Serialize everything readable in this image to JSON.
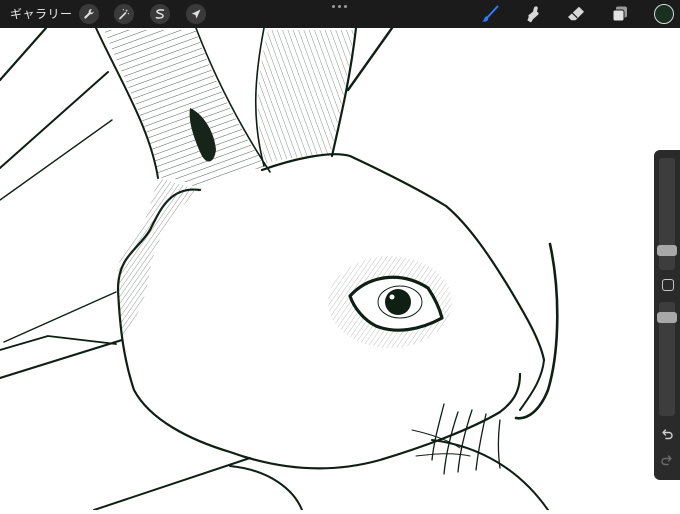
{
  "toolbar": {
    "gallery_label": "ギャラリー",
    "left_tools": [
      "wrench-icon",
      "magic-wand-icon",
      "selection-icon",
      "transform-arrow-icon"
    ],
    "right_tools": [
      "brush-icon",
      "smudge-icon",
      "eraser-icon",
      "layers-icon"
    ],
    "active_tool": "brush-icon",
    "active_color": "#17301f"
  },
  "sidebar": {
    "brush_size_level": 0.55,
    "opacity_level": 0.72,
    "buttons": [
      "modify-square-icon",
      "undo-icon",
      "redo-icon"
    ]
  },
  "colors": {
    "toolbar_bg": "#1b1b1b",
    "accent_brush": "#2f7bff",
    "ink": "#0f1f14"
  }
}
